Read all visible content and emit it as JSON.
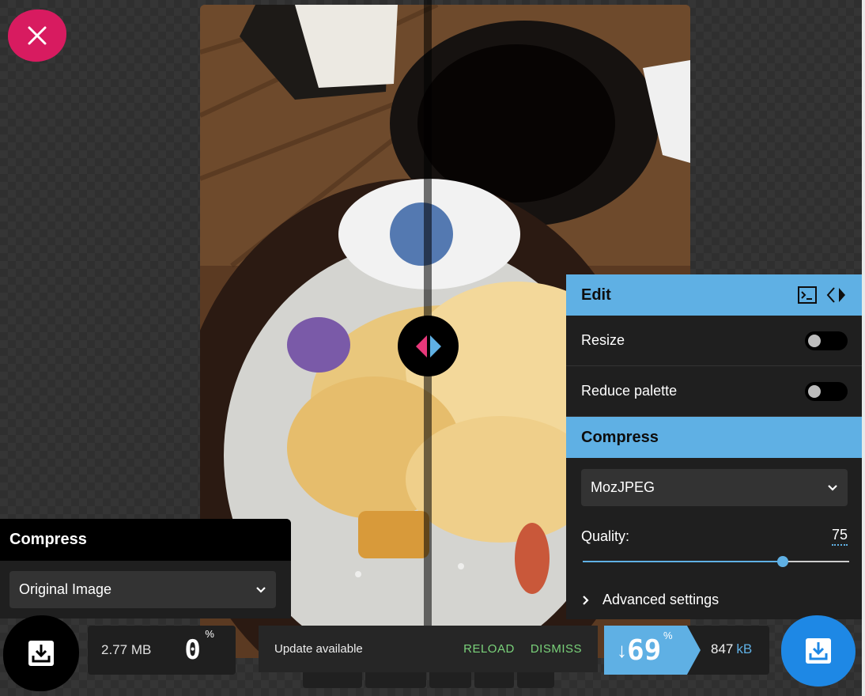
{
  "close": {
    "icon": "close-icon",
    "color": "#d81b60"
  },
  "left_panel": {
    "heading": "Compress",
    "method": "Original Image"
  },
  "left_stats": {
    "size_value": "2.77",
    "size_unit": "MB",
    "percent": "0",
    "percent_sign": "%"
  },
  "right_panel": {
    "edit_heading": "Edit",
    "resize_label": "Resize",
    "resize_enabled": false,
    "reduce_palette_label": "Reduce palette",
    "reduce_palette_enabled": false,
    "compress_heading": "Compress",
    "method": "MozJPEG",
    "quality_label": "Quality:",
    "quality_value": "75",
    "quality_fraction": 0.75,
    "advanced_label": "Advanced settings"
  },
  "toast": {
    "message": "Update available",
    "reload": "RELOAD",
    "dismiss": "DISMISS"
  },
  "right_stats": {
    "arrow": "↓",
    "percent": "69",
    "percent_sign": "%",
    "size_value": "847",
    "size_unit": "kB"
  },
  "colors": {
    "accent_blue": "#5fb0e4",
    "close_pink": "#d81b60",
    "toast_action_green": "#7ad27a",
    "download_blue": "#1e88e5"
  }
}
